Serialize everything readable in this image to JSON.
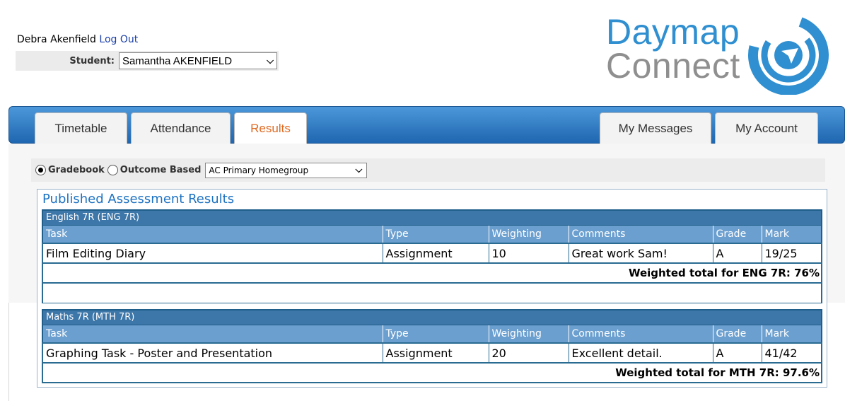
{
  "user": {
    "name": "Debra Akenfield",
    "logout_label": "Log Out"
  },
  "student": {
    "label": "Student:",
    "selected": "Samantha AKENFIELD"
  },
  "logo": {
    "line1": "Daymap",
    "line2": "Connect"
  },
  "nav": {
    "tabs": [
      {
        "label": "Timetable",
        "active": false
      },
      {
        "label": "Attendance",
        "active": false
      },
      {
        "label": "Results",
        "active": true
      },
      {
        "label": "My Messages",
        "active": false
      },
      {
        "label": "My Account",
        "active": false
      }
    ]
  },
  "filters": {
    "gradebook_label": "Gradebook",
    "outcome_label": "Outcome Based",
    "selected_mode": "Gradebook",
    "class_selected": "AC Primary Homegroup"
  },
  "results": {
    "title": "Published Assessment Results",
    "columns": [
      "Task",
      "Type",
      "Weighting",
      "Comments",
      "Grade",
      "Mark"
    ],
    "courses": [
      {
        "name": "English 7R (ENG 7R)",
        "rows": [
          {
            "task": "Film Editing Diary",
            "type": "Assignment",
            "weighting": "10",
            "comments": "Great work Sam!",
            "grade": "A",
            "mark": "19/25"
          }
        ],
        "total": "Weighted total for ENG 7R: 76%"
      },
      {
        "name": "Maths 7R (MTH 7R)",
        "rows": [
          {
            "task": "Graphing Task - Poster and Presentation",
            "type": "Assignment",
            "weighting": "20",
            "comments": "Excellent detail.",
            "grade": "A",
            "mark": "41/42"
          }
        ],
        "total": "Weighted total for MTH 7R: 97.6%"
      }
    ]
  },
  "colors": {
    "brand_blue": "#2f8fd0",
    "brand_grey": "#8f8f8f",
    "nav_blue": "#2a74bd",
    "active_tab": "#e06a22",
    "table_header": "#6b9fcf",
    "course_header": "#3d76a8"
  }
}
